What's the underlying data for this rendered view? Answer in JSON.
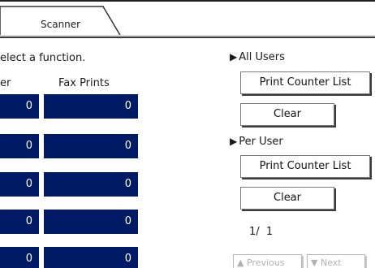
{
  "tab": {
    "label": "Scanner"
  },
  "prompt": "elect a function.",
  "columns": {
    "left_header": "er",
    "fax_header": "Fax Prints"
  },
  "rows": [
    {
      "left": "0",
      "fax": "0"
    },
    {
      "left": "0",
      "fax": "0"
    },
    {
      "left": "0",
      "fax": "0"
    },
    {
      "left": "0",
      "fax": "0"
    },
    {
      "left": "0",
      "fax": "0"
    }
  ],
  "all_users": {
    "label": "All Users",
    "print_label": "Print Counter List",
    "clear_label": "Clear"
  },
  "per_user": {
    "label": "Per User",
    "print_label": "Print Counter List",
    "clear_label": "Clear"
  },
  "pager": {
    "indicator": "1/  1",
    "previous_label": "Previous",
    "next_label": "Next"
  },
  "icons": {
    "section_marker": "triangle-right-icon",
    "previous": "triangle-up-icon",
    "next": "triangle-down-icon"
  }
}
